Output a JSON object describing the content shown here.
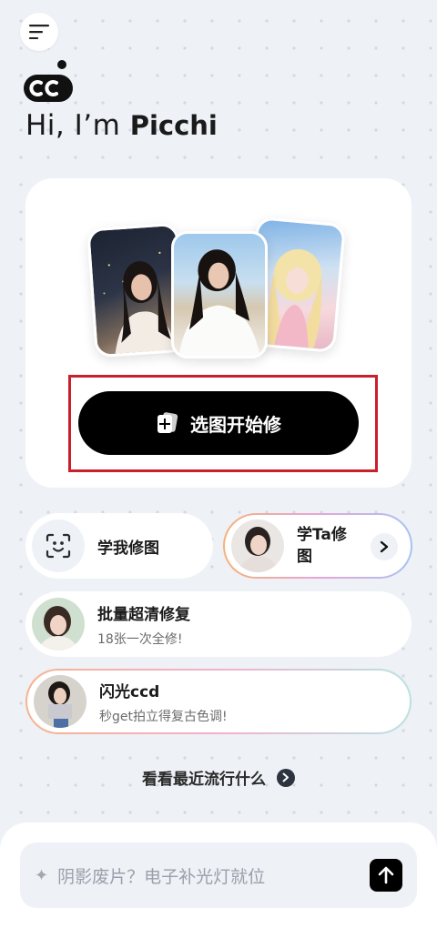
{
  "header": {
    "menu_icon": "menu-lines-icon",
    "logo_text": "CC",
    "greeting_prefix": "Hi, I’m ",
    "brand_name": "Picchi"
  },
  "hero": {
    "photo_count": 3,
    "start_button_icon": "add-photo-icon",
    "start_button_label": "选图开始修"
  },
  "features": {
    "learn_me": {
      "icon": "face-scan-icon",
      "title": "学我修图"
    },
    "learn_ta": {
      "title": "学Ta修图",
      "action_icon": "chevron-right-icon"
    },
    "batch": {
      "title": "批量超清修复",
      "subtitle": "18张一次全修!"
    },
    "flash": {
      "title": "闪光ccd",
      "subtitle": "秒get拍立得复古色调!"
    }
  },
  "trend_link": {
    "label": "看看最近流行什么",
    "icon": "chevron-right-icon"
  },
  "composer": {
    "sparkle_icon": "sparkle-icon",
    "placeholder": "阴影废片？电子补光灯就位",
    "send_icon": "arrow-up-icon"
  },
  "colors": {
    "background": "#eef1f6",
    "primary_button": "#000000",
    "highlight_border": "#c9202b"
  }
}
